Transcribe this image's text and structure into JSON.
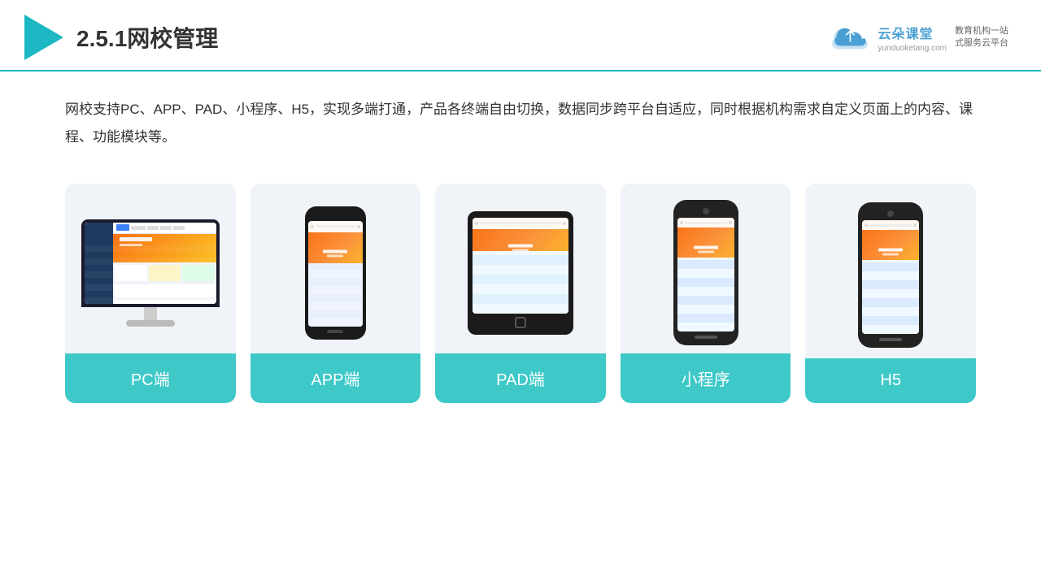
{
  "header": {
    "title": "2.5.1网校管理",
    "brand": {
      "name": "云朵课堂",
      "url": "yunduoketang.com",
      "slogan_line1": "教育机构一站",
      "slogan_line2": "式服务云平台"
    }
  },
  "description": {
    "text": "网校支持PC、APP、PAD、小程序、H5，实现多端打通，产品各终端自由切换，数据同步跨平台自适应，同时根据机构需求自定义页面上的内容、课程、功能模块等。"
  },
  "cards": [
    {
      "id": "pc",
      "label": "PC端",
      "type": "pc"
    },
    {
      "id": "app",
      "label": "APP端",
      "type": "phone"
    },
    {
      "id": "pad",
      "label": "PAD端",
      "type": "tablet"
    },
    {
      "id": "miniprogram",
      "label": "小程序",
      "type": "miniphone"
    },
    {
      "id": "h5",
      "label": "H5",
      "type": "miniphone"
    }
  ],
  "colors": {
    "teal": "#3ec8c8",
    "header_line": "#1db8c4",
    "triangle": "#1db8c4",
    "text_primary": "#333333",
    "bg_card": "#eef2f8"
  }
}
